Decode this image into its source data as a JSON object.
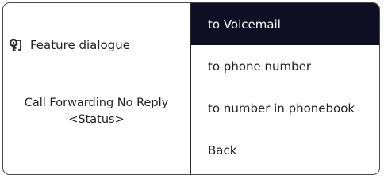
{
  "left_panel": {
    "feature_icon": "key-lock-icon",
    "feature_title": "Feature dialogue",
    "status_line1": "Call Forwarding No Reply",
    "status_line2": "<Status>"
  },
  "menu": {
    "items": [
      {
        "label": "to Voicemail",
        "selected": true
      },
      {
        "label": "to phone number",
        "selected": false
      },
      {
        "label": "to number in phonebook",
        "selected": false
      },
      {
        "label": "Back",
        "selected": false
      }
    ]
  },
  "colors": {
    "selected_bg": "#0f0f24",
    "selected_text": "#ffffff",
    "text": "#222222",
    "border": "#4a4a4a"
  }
}
